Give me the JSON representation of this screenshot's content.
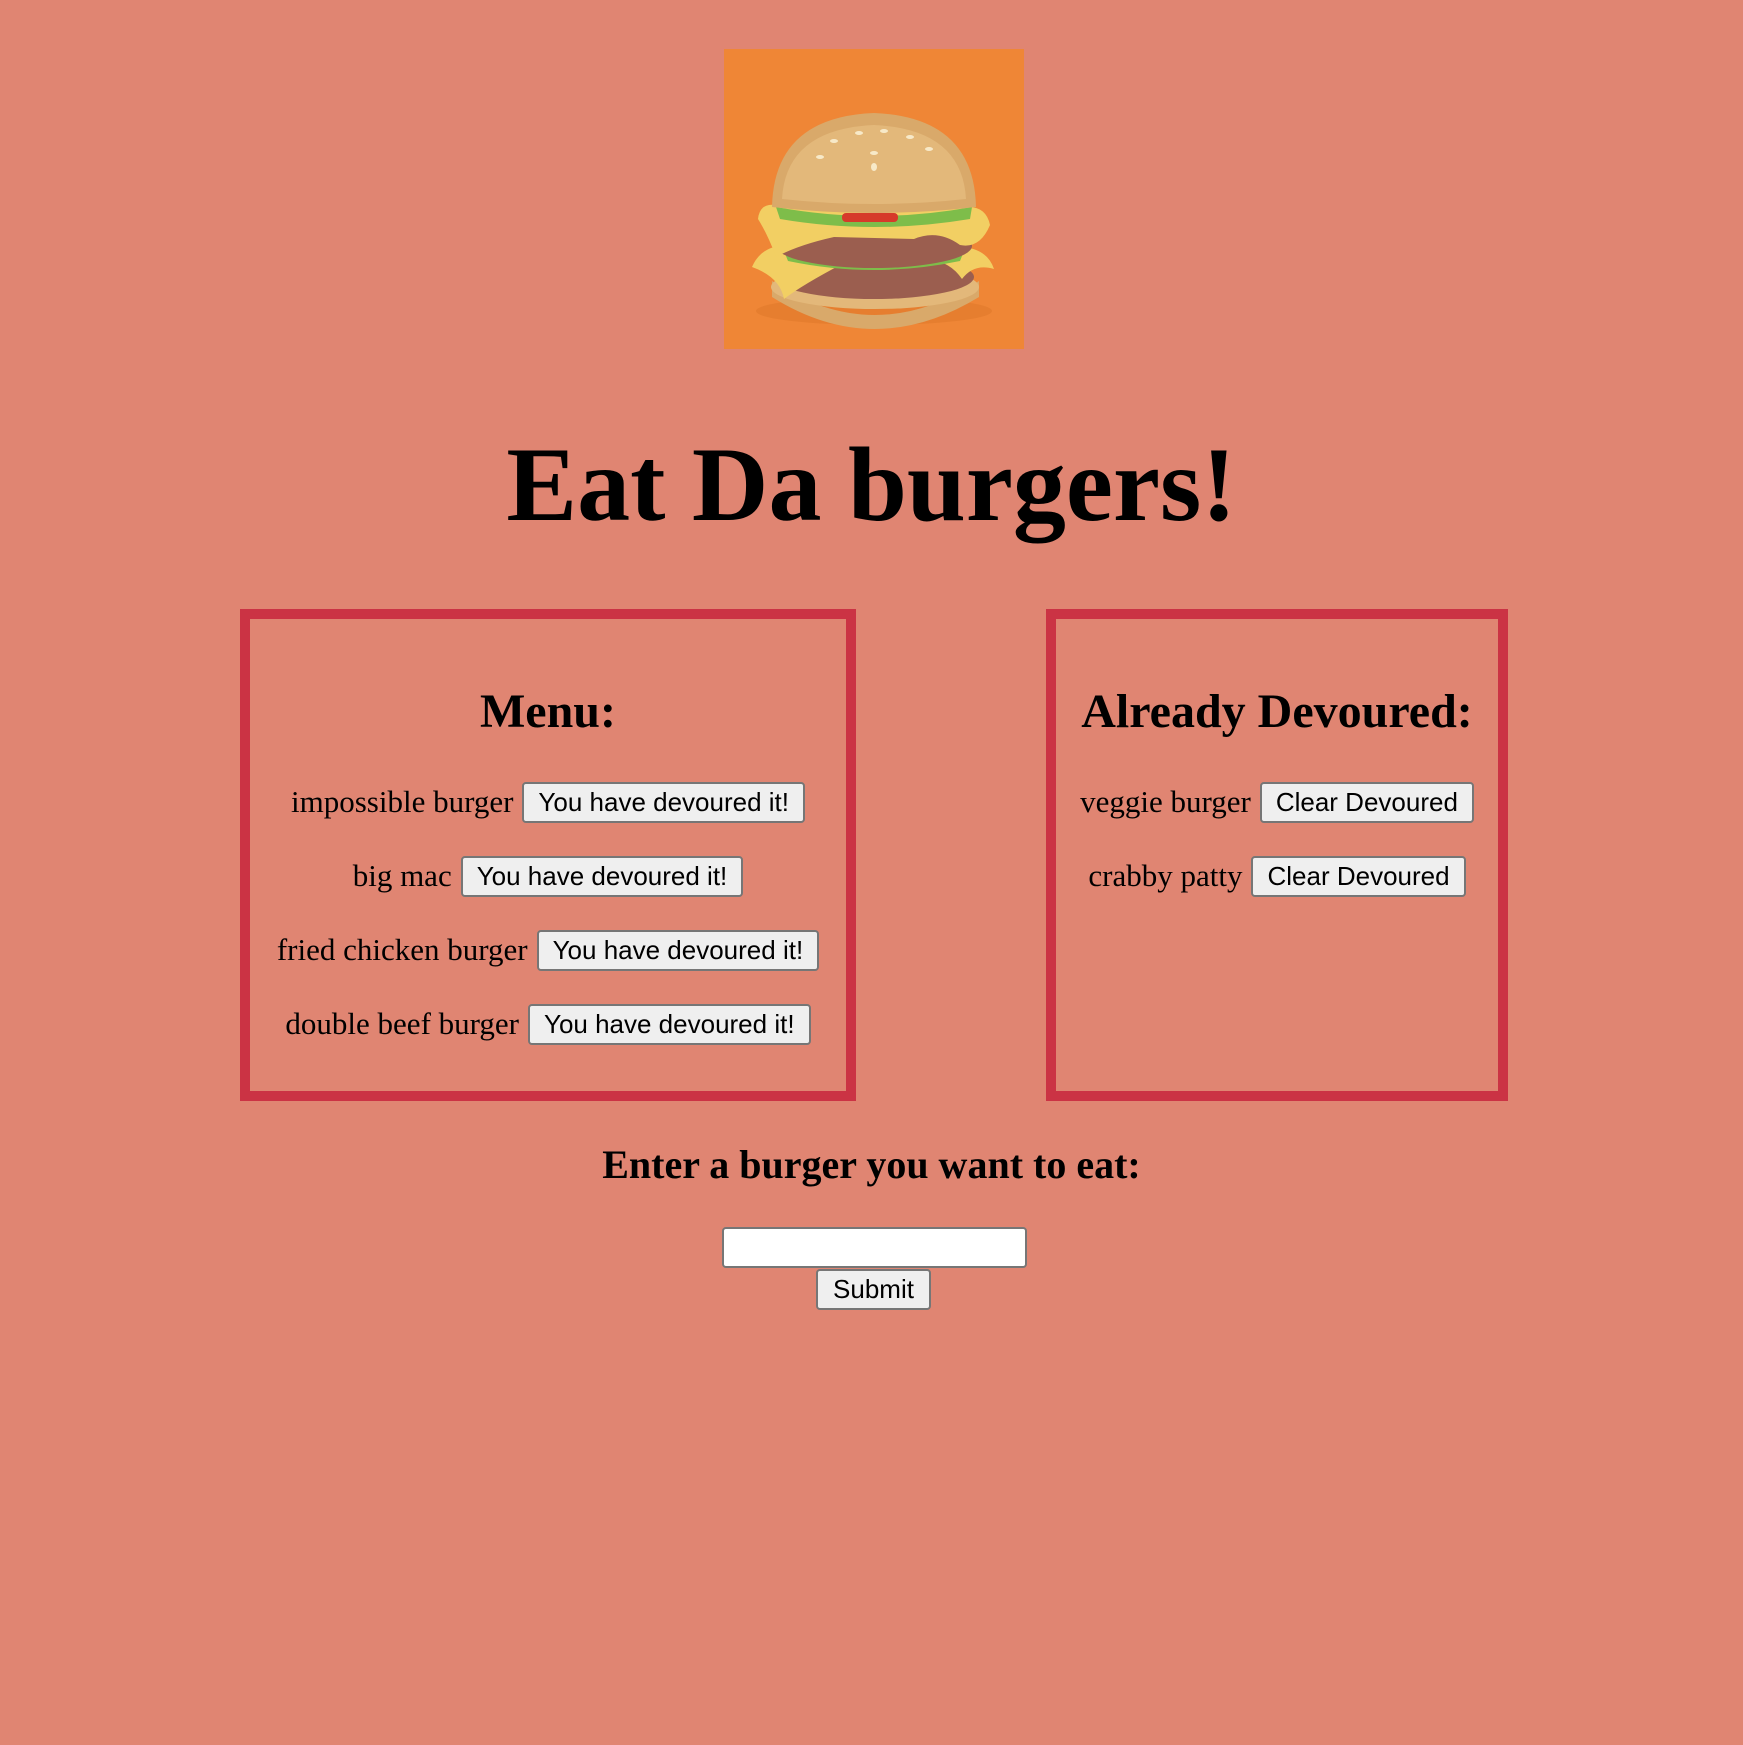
{
  "logo": {
    "icon": "burger-icon",
    "background_color": "#ef8636"
  },
  "title": "Eat Da burgers!",
  "menu": {
    "heading": "Menu:",
    "items": [
      {
        "name": "impossible burger",
        "button": "You have devoured it!"
      },
      {
        "name": "big mac",
        "button": "You have devoured it!"
      },
      {
        "name": "fried chicken burger",
        "button": "You have devoured it!"
      },
      {
        "name": "double beef burger",
        "button": "You have devoured it!"
      }
    ]
  },
  "devoured": {
    "heading": "Already Devoured:",
    "items": [
      {
        "name": "veggie burger",
        "button": "Clear Devoured"
      },
      {
        "name": "crabby patty",
        "button": "Clear Devoured"
      }
    ]
  },
  "form": {
    "heading": "Enter a burger you want to eat:",
    "input_value": "",
    "submit_label": "Submit"
  },
  "colors": {
    "page_background": "#e08572",
    "panel_border": "#cb3344"
  }
}
